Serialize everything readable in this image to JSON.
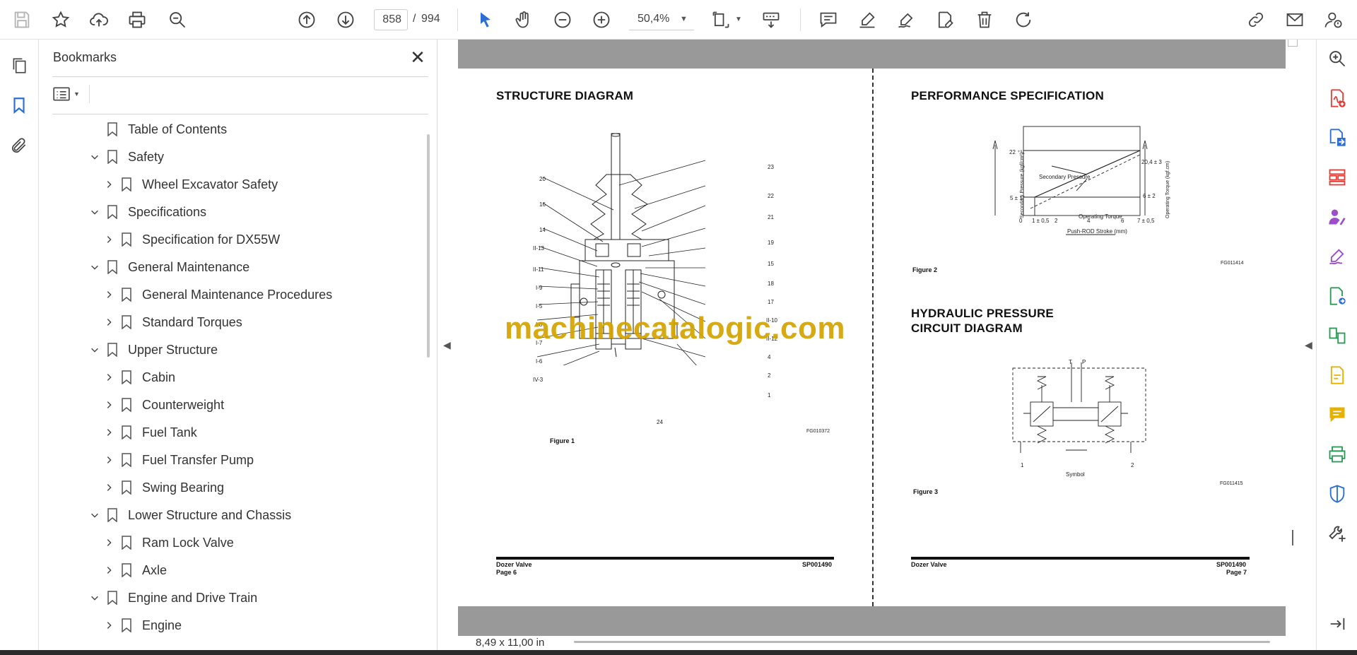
{
  "toolbar": {
    "page_current": "858",
    "page_separator": "/",
    "page_total": "994",
    "zoom": "50,4%",
    "icons": [
      "save-icon",
      "bookmark-star-icon",
      "upload-cloud-icon",
      "print-icon",
      "find-icon",
      "previous-page-icon",
      "next-page-icon",
      "select-cursor-icon",
      "hand-icon",
      "zoom-out-icon",
      "zoom-in-icon",
      "zoom-dropdown",
      "page-fit-icon",
      "scroll-mode-icon",
      "comment-icon",
      "highlight-icon",
      "sign-icon",
      "fill-sign-icon",
      "delete-icon",
      "rotate-icon",
      "share-link-icon",
      "email-icon",
      "account-icon"
    ]
  },
  "left_rail": {
    "icons": [
      "pages-thumbnail-icon",
      "bookmarks-icon",
      "attachments-icon"
    ]
  },
  "bookmarks": {
    "title": "Bookmarks",
    "close": "✕",
    "items": [
      {
        "label": "Table of Contents",
        "level": 0,
        "expand": "none"
      },
      {
        "label": "Safety",
        "level": 0,
        "expand": "open"
      },
      {
        "label": "Wheel Excavator Safety",
        "level": 1,
        "expand": "closed"
      },
      {
        "label": "Specifications",
        "level": 0,
        "expand": "open"
      },
      {
        "label": "Specification for DX55W",
        "level": 1,
        "expand": "closed"
      },
      {
        "label": "General Maintenance",
        "level": 0,
        "expand": "open"
      },
      {
        "label": "General Maintenance Procedures",
        "level": 1,
        "expand": "closed"
      },
      {
        "label": "Standard Torques",
        "level": 1,
        "expand": "closed"
      },
      {
        "label": "Upper Structure",
        "level": 0,
        "expand": "open"
      },
      {
        "label": "Cabin",
        "level": 1,
        "expand": "closed"
      },
      {
        "label": "Counterweight",
        "level": 1,
        "expand": "closed"
      },
      {
        "label": "Fuel Tank",
        "level": 1,
        "expand": "closed"
      },
      {
        "label": "Fuel Transfer Pump",
        "level": 1,
        "expand": "closed"
      },
      {
        "label": "Swing Bearing",
        "level": 1,
        "expand": "closed"
      },
      {
        "label": "Lower Structure and Chassis",
        "level": 0,
        "expand": "open"
      },
      {
        "label": "Ram Lock Valve",
        "level": 1,
        "expand": "closed"
      },
      {
        "label": "Axle",
        "level": 1,
        "expand": "closed"
      },
      {
        "label": "Engine and Drive Train",
        "level": 0,
        "expand": "open"
      },
      {
        "label": "Engine",
        "level": 1,
        "expand": "closed"
      }
    ]
  },
  "document": {
    "left_page": {
      "heading": "STRUCTURE DIAGRAM",
      "figure_caption": "Figure 1",
      "figure_code": "FG010372",
      "callouts_left": [
        "20",
        "16",
        "14",
        "II-13",
        "II-11",
        "I-9",
        "I-5",
        "I-8",
        "I-7",
        "I-6",
        "IV-3"
      ],
      "callouts_right": [
        "23",
        "22",
        "21",
        "19",
        "15",
        "18",
        "17",
        "II-10",
        "II-12",
        "4",
        "2",
        "1"
      ],
      "callout_bottom": "24",
      "footer_title": "Dozer Valve",
      "footer_page": "Page 6",
      "footer_code": "SP001490"
    },
    "right_page": {
      "heading": "PERFORMANCE SPECIFICATION",
      "fig2_caption": "Figure 2",
      "fig2_code": "FG011414",
      "graph": {
        "ylabel_left": "Secondary Pressure (kgf/cm²)",
        "ylabel_right": "Operating Torque (kgf.cm)",
        "xlabel": "Push-ROD Stroke (mm)",
        "label_secondary": "Secondary Pressure",
        "label_torque": "Operating Torque",
        "y_left_top": "22 ⁺³₀",
        "y_left_low": "5 ± 1",
        "y_right_top": "20,4 ± 3",
        "y_right_low": "6 ± 2",
        "x_ticks": [
          "0",
          "1 ± 0,5",
          "2",
          "4",
          "6",
          "7 ± 0,5"
        ]
      },
      "heading2_line1": "HYDRAULIC PRESSURE",
      "heading2_line2": "CIRCUIT DIAGRAM",
      "fig3_caption": "Figure 3",
      "fig3_code": "FG011415",
      "circuit": {
        "port_t": "T",
        "port_p": "P",
        "port_1": "1",
        "port_2": "2",
        "symbol": "Symbol"
      },
      "footer_title": "Dozer Valve",
      "footer_page": "Page 7",
      "footer_code": "SP001490"
    },
    "watermark": "machinecatalogic.com",
    "page_size": "8,49 x 11,00 in"
  },
  "right_rail": {
    "icons": [
      "search-zoom-icon",
      "create-pdf-icon",
      "export-pdf-icon",
      "organize-pages-icon",
      "request-signatures-icon",
      "fill-sign-icon",
      "export-to-icon",
      "compare-files-icon",
      "edit-pdf-icon",
      "comment-icon",
      "print-production-icon",
      "protect-icon",
      "more-tools-icon",
      "collapse-rail-icon"
    ],
    "colors": {
      "red": "#e0403a",
      "blue": "#2b6fd6",
      "purple": "#9b4dca",
      "green": "#2c9b58",
      "yellow": "#e8b100",
      "dark": "#444444"
    }
  }
}
